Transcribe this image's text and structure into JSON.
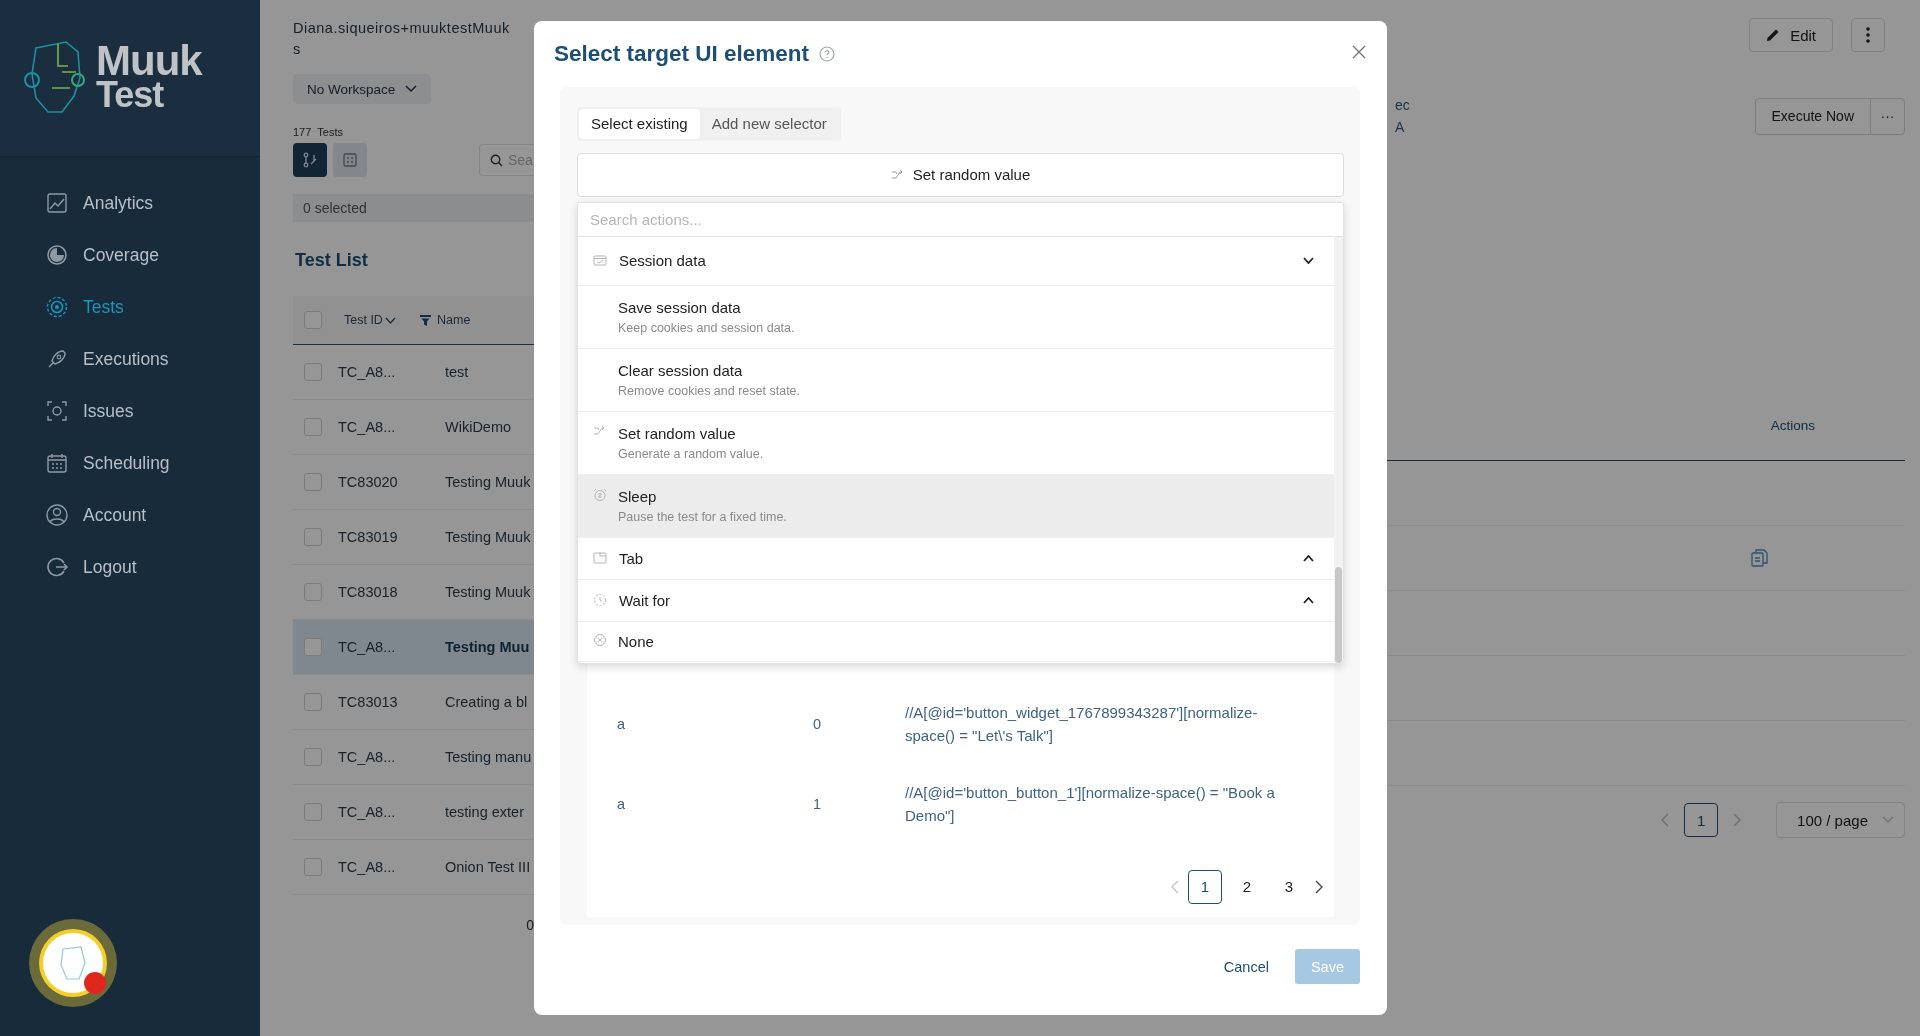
{
  "sidebar": {
    "logo_lines": [
      "Muuk",
      "Test"
    ],
    "items": [
      {
        "label": "Analytics",
        "selected": false
      },
      {
        "label": "Coverage",
        "selected": false
      },
      {
        "label": "Tests",
        "selected": true
      },
      {
        "label": "Executions",
        "selected": false
      },
      {
        "label": "Issues",
        "selected": false
      },
      {
        "label": "Scheduling",
        "selected": false
      },
      {
        "label": "Account",
        "selected": false
      },
      {
        "label": "Logout",
        "selected": false
      }
    ]
  },
  "background": {
    "account_lines": [
      "Diana.siqueiros+muuktestMuuk",
      "s"
    ],
    "workspace": "No Workspace",
    "test_count": "177",
    "test_count_label": "Tests",
    "view_toggles": [
      {
        "selected": true
      },
      {
        "selected": false
      }
    ],
    "search": {
      "placeholder": "Sea"
    },
    "selection": "0 selected",
    "list_title": "Test List",
    "header_checked": false,
    "columns": [
      "Test ID",
      "Name"
    ],
    "rows": [
      {
        "id": "TC_A8...",
        "name": "test",
        "selected": false
      },
      {
        "id": "TC_A8...",
        "name": "WikiDemo",
        "selected": false
      },
      {
        "id": "TC83020",
        "name": "Testing Muuk",
        "selected": false
      },
      {
        "id": "TC83019",
        "name": "Testing Muuk",
        "selected": false
      },
      {
        "id": "TC83018",
        "name": "Testing Muuk",
        "selected": false
      },
      {
        "id": "TC_A8...",
        "name": "Testing Muu",
        "selected": true
      },
      {
        "id": "TC83013",
        "name": "Creating a bl",
        "selected": false
      },
      {
        "id": "TC_A8...",
        "name": "Testing manu",
        "selected": false
      },
      {
        "id": "TC_A8...",
        "name": "testing exter",
        "selected": false
      },
      {
        "id": "TC_A8...",
        "name": "Onion Test III",
        "selected": false
      }
    ],
    "list_footer": "0",
    "edit_button": "Edit",
    "fragments": [
      "ec",
      "A"
    ],
    "execute_button": "Execute Now",
    "more_button": "···",
    "actions_header": "Actions",
    "pages": [
      {
        "label": "1",
        "selected": true
      }
    ],
    "page_size": "100 / page"
  },
  "modal": {
    "title": "Select target UI element",
    "tabs": [
      {
        "label": "Select existing",
        "selected": true
      },
      {
        "label": "Add new selector",
        "selected": false
      }
    ],
    "current_action": "Set random value",
    "search": {
      "placeholder": "Search actions..."
    },
    "actions": [
      {
        "kind": "group",
        "label": "Session data",
        "expanded": true
      },
      {
        "kind": "action",
        "title": "Save session data",
        "description": "Keep cookies and session data.",
        "selected": false
      },
      {
        "kind": "action",
        "title": "Clear session data",
        "description": "Remove cookies and reset state.",
        "selected": false
      },
      {
        "kind": "action",
        "title": "Set random value",
        "description": "Generate a random value.",
        "selected": false
      },
      {
        "kind": "action",
        "title": "Sleep",
        "description": "Pause the test for a fixed time.",
        "selected": true
      },
      {
        "kind": "group",
        "label": "Tab",
        "expanded": false
      },
      {
        "kind": "group",
        "label": "Wait for",
        "expanded": false
      },
      {
        "kind": "action",
        "title": "None",
        "selected": false
      }
    ],
    "rows": [
      {
        "tag": "a",
        "index": "0",
        "xpath": "//A[@id='button_widget_1767899343287'][normalize-space() = \"Let\\'s Talk\"]"
      },
      {
        "tag": "a",
        "index": "1",
        "xpath": "//A[@id='button_button_1'][normalize-space() = \"Book a Demo\"]"
      }
    ],
    "pages": [
      {
        "label": "1",
        "selected": true
      },
      {
        "label": "2",
        "selected": false
      },
      {
        "label": "3",
        "selected": false
      }
    ],
    "cancel_button": "Cancel",
    "save_button": {
      "label": "Save",
      "disabled": true
    }
  }
}
